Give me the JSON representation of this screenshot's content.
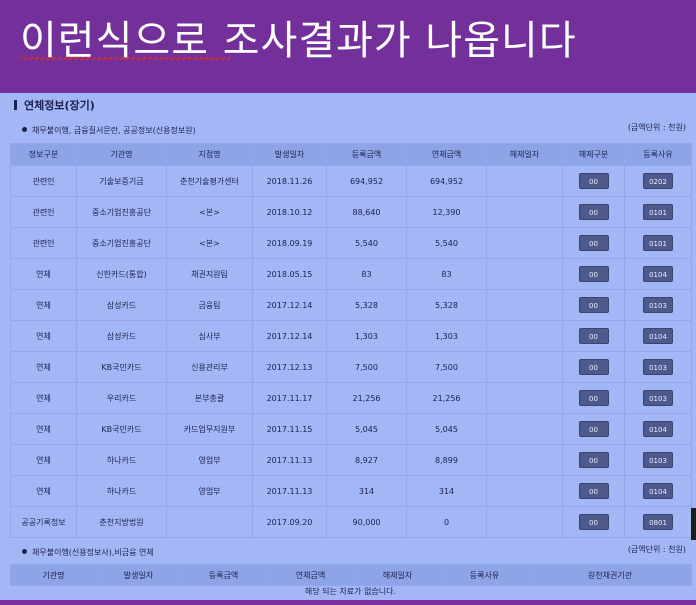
{
  "banner": {
    "text": "이런식으로 조사결과가 나옵니다"
  },
  "section": {
    "title": "연체정보(장기)"
  },
  "block1": {
    "subtitle": "채무불이행, 금융질서문란, 공공정보(신용정보원)",
    "unit": "(금액단위 : 천원)",
    "headers": [
      "정보구분",
      "기관명",
      "지점명",
      "발생일자",
      "등록금액",
      "연체금액",
      "해제일자",
      "해제구분",
      "등록사유"
    ],
    "rows": [
      [
        "관련인",
        "기술보증기금",
        "춘천기술평가센터",
        "2018.11.26",
        "694,952",
        "694,952",
        "",
        "00",
        "0202"
      ],
      [
        "관련인",
        "중소기업진흥공단",
        "<본>",
        "2018.10.12",
        "88,640",
        "12,390",
        "",
        "00",
        "0101"
      ],
      [
        "관련인",
        "중소기업진흥공단",
        "<본>",
        "2018.09.19",
        "5,540",
        "5,540",
        "",
        "00",
        "0101"
      ],
      [
        "연체",
        "신한카드(통합)",
        "채권지원팀",
        "2018.05.15",
        "83",
        "83",
        "",
        "00",
        "0104"
      ],
      [
        "연체",
        "삼성카드",
        "금융팀",
        "2017.12.14",
        "5,328",
        "5,328",
        "",
        "00",
        "0103"
      ],
      [
        "연체",
        "삼성카드",
        "심사부",
        "2017.12.14",
        "1,303",
        "1,303",
        "",
        "00",
        "0104"
      ],
      [
        "연체",
        "KB국민카드",
        "신용관리부",
        "2017.12.13",
        "7,500",
        "7,500",
        "",
        "00",
        "0103"
      ],
      [
        "연체",
        "우리카드",
        "본부총괄",
        "2017.11.17",
        "21,256",
        "21,256",
        "",
        "00",
        "0103"
      ],
      [
        "연체",
        "KB국민카드",
        "카드업무지원부",
        "2017.11.15",
        "5,045",
        "5,045",
        "",
        "00",
        "0104"
      ],
      [
        "연체",
        "하나카드",
        "영업부",
        "2017.11.13",
        "8,927",
        "8,899",
        "",
        "00",
        "0103"
      ],
      [
        "연체",
        "하나카드",
        "영업부",
        "2017.11.13",
        "314",
        "314",
        "",
        "00",
        "0104"
      ],
      [
        "공공기록정보",
        "춘천지방법원",
        "",
        "2017.09.20",
        "90,000",
        "0",
        "",
        "00",
        "0801"
      ]
    ]
  },
  "block2": {
    "subtitle": "채무불이행(신용정보사),비금융 연체",
    "unit": "(금액단위 : 천원)",
    "headers": [
      "기관명",
      "발생일자",
      "등록금액",
      "연체금액",
      "해제일자",
      "등록사유",
      "원천채권기관"
    ],
    "empty_message": "해당 되는 자료가 없습니다."
  }
}
